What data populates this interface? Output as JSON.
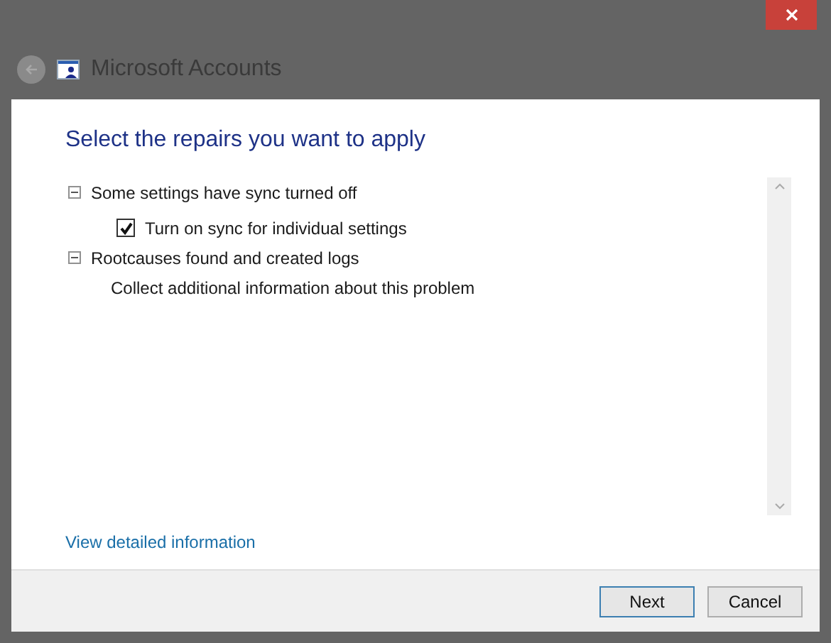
{
  "window": {
    "title": "Microsoft Accounts"
  },
  "heading": "Select the repairs you want to apply",
  "tree": [
    {
      "label": "Some settings have sync turned off",
      "kind": "group",
      "expanded": true,
      "children": [
        {
          "label": "Turn on sync for individual settings",
          "kind": "checkbox",
          "checked": true
        }
      ]
    },
    {
      "label": "Rootcauses found and created logs",
      "kind": "group",
      "expanded": true,
      "children": [
        {
          "label": "Collect additional information about this problem",
          "kind": "text"
        }
      ]
    }
  ],
  "details_link": "View detailed information",
  "buttons": [
    {
      "label": "Next",
      "default": true
    },
    {
      "label": "Cancel",
      "default": false
    }
  ]
}
